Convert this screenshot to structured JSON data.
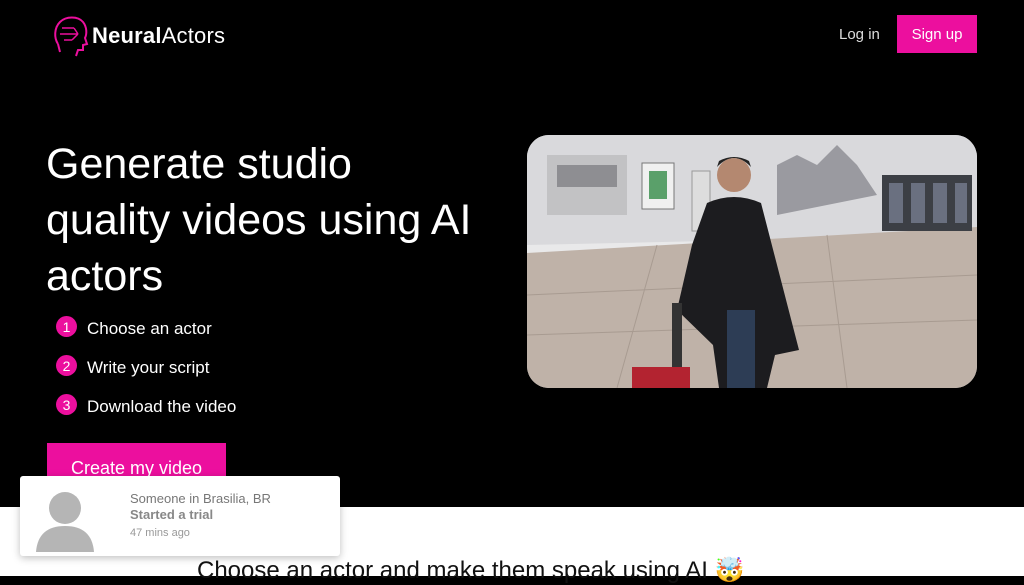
{
  "header": {
    "logo": {
      "part1": "Neural",
      "part2": "Actors",
      "icon": "head-outline-icon"
    },
    "login_label": "Log in",
    "signup_label": "Sign up"
  },
  "hero": {
    "title": "Generate studio quality videos using AI actors",
    "steps": [
      {
        "num": "1",
        "label": "Choose an actor"
      },
      {
        "num": "2",
        "label": "Write your script"
      },
      {
        "num": "3",
        "label": "Download the video"
      }
    ],
    "cta_label": "Create my video"
  },
  "section": {
    "title": "Choose an actor and make them speak using AI 🤯"
  },
  "toast": {
    "line1": "Someone in Brasilia, BR",
    "line2": "Started a trial",
    "line3": "47 mins ago",
    "avatar_icon": "user-avatar-icon"
  },
  "colors": {
    "accent": "#ec0f9e",
    "background": "#000000"
  }
}
